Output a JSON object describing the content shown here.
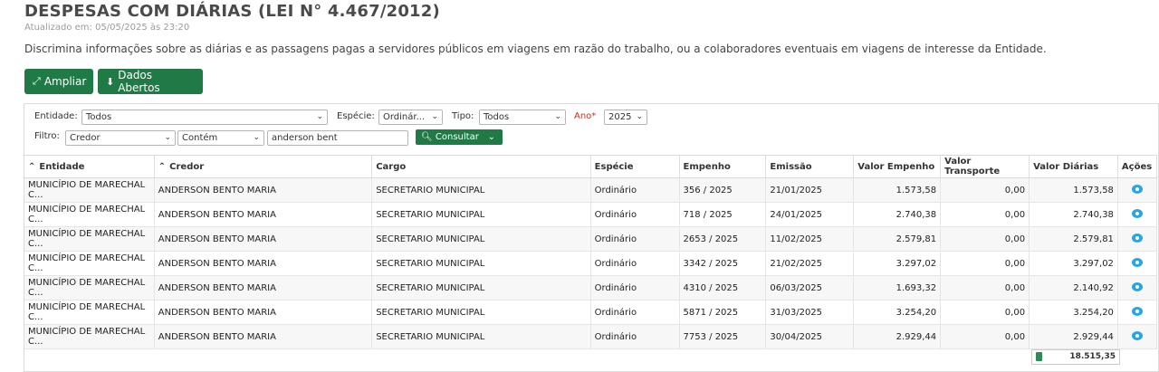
{
  "page": {
    "title": "DESPESAS COM DIÁRIAS (LEI N° 4.467/2012)",
    "updated": "Atualizado em: 05/05/2025 às 23:20",
    "description": "Discrimina informações sobre as diárias e as passagens pagas a servidores públicos em viagens em razão do trabalho, ou a colaboradores eventuais em viagens de interesse da Entidade."
  },
  "buttons": {
    "ampliar": "Ampliar",
    "dados_abertos": "Dados Abertos",
    "consultar": "Consultar"
  },
  "filters": {
    "entidade_label": "Entidade:",
    "entidade_value": "Todos",
    "especie_label": "Espécie:",
    "especie_value": "Ordinár...",
    "tipo_label": "Tipo:",
    "tipo_value": "Todos",
    "ano_label": "Ano*",
    "ano_value": "2025",
    "filtro_label": "Filtro:",
    "filtro_field": "Credor",
    "filtro_op": "Contém",
    "filtro_text": "anderson bent"
  },
  "table": {
    "headers": [
      "Entidade",
      "Credor",
      "Cargo",
      "Espécie",
      "Empenho",
      "Emissão",
      "Valor Empenho",
      "Valor Transporte",
      "Valor Diárias",
      "Ações"
    ],
    "rows": [
      [
        "MUNICÍPIO DE MARECHAL C...",
        "ANDERSON BENTO MARIA",
        "SECRETARIO MUNICIPAL",
        "Ordinário",
        "356 / 2025",
        "21/01/2025",
        "1.573,58",
        "0,00",
        "1.573,58"
      ],
      [
        "MUNICÍPIO DE MARECHAL C...",
        "ANDERSON BENTO MARIA",
        "SECRETARIO MUNICIPAL",
        "Ordinário",
        "718 / 2025",
        "24/01/2025",
        "2.740,38",
        "0,00",
        "2.740,38"
      ],
      [
        "MUNICÍPIO DE MARECHAL C...",
        "ANDERSON BENTO MARIA",
        "SECRETARIO MUNICIPAL",
        "Ordinário",
        "2653 / 2025",
        "11/02/2025",
        "2.579,81",
        "0,00",
        "2.579,81"
      ],
      [
        "MUNICÍPIO DE MARECHAL C...",
        "ANDERSON BENTO MARIA",
        "SECRETARIO MUNICIPAL",
        "Ordinário",
        "3342 / 2025",
        "21/02/2025",
        "3.297,02",
        "0,00",
        "3.297,02"
      ],
      [
        "MUNICÍPIO DE MARECHAL C...",
        "ANDERSON BENTO MARIA",
        "SECRETARIO MUNICIPAL",
        "Ordinário",
        "4310 / 2025",
        "06/03/2025",
        "1.693,32",
        "0,00",
        "2.140,92"
      ],
      [
        "MUNICÍPIO DE MARECHAL C...",
        "ANDERSON BENTO MARIA",
        "SECRETARIO MUNICIPAL",
        "Ordinário",
        "5871 / 2025",
        "31/03/2025",
        "3.254,20",
        "0,00",
        "3.254,20"
      ],
      [
        "MUNICÍPIO DE MARECHAL C...",
        "ANDERSON BENTO MARIA",
        "SECRETARIO MUNICIPAL",
        "Ordinário",
        "7753 / 2025",
        "30/04/2025",
        "2.929,44",
        "0,00",
        "2.929,44"
      ]
    ],
    "total_diarias": "18.515,35"
  },
  "icons": {
    "expand": "expand-icon",
    "download": "download-icon",
    "search": "search-icon",
    "view": "eye-icon",
    "calculator": "calculator-icon"
  },
  "colors": {
    "primary_green": "#1f7a45",
    "eye_blue": "#27a6df",
    "required_red": "#c0392b"
  }
}
